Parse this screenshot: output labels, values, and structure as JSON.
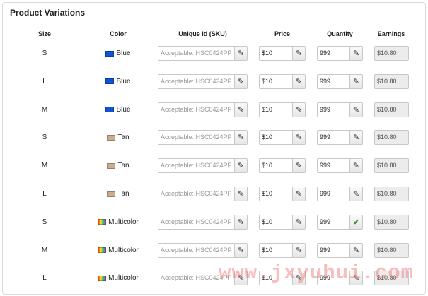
{
  "section_title": "Product Variations",
  "columns": [
    "Size",
    "Color",
    "Unique Id (SKU)",
    "Price",
    "Quantity",
    "Earnings"
  ],
  "icons": {
    "edit": "pencil-icon",
    "confirm": "checkmark-icon"
  },
  "glyphs": {
    "edit": "✎",
    "confirm": "✔"
  },
  "colors": {
    "blue": "#1152d6",
    "tan": "#c9ae8c",
    "multicolor": "linear-gradient(90deg,#e33,#f90,#ee2,#3c3,#39f,#93f)"
  },
  "rows": [
    {
      "size": "S",
      "color": "Blue",
      "swatch": "#1152d6",
      "sku_placeholder": "Acceptable: HSC0424PP",
      "price": "$10",
      "quantity": "999",
      "quantity_icon": "✎",
      "earnings": "$10.80"
    },
    {
      "size": "L",
      "color": "Blue",
      "swatch": "#1152d6",
      "sku_placeholder": "Acceptable: HSC0424PP",
      "price": "$10",
      "quantity": "999",
      "quantity_icon": "✎",
      "earnings": "$10.80"
    },
    {
      "size": "M",
      "color": "Blue",
      "swatch": "#1152d6",
      "sku_placeholder": "Acceptable: HSC0424PP",
      "price": "$10",
      "quantity": "999",
      "quantity_icon": "✎",
      "earnings": "$10.80"
    },
    {
      "size": "S",
      "color": "Tan",
      "swatch": "#c9ae8c",
      "sku_placeholder": "Acceptable: HSC0424PP",
      "price": "$10",
      "quantity": "999",
      "quantity_icon": "✎",
      "earnings": "$10.80"
    },
    {
      "size": "M",
      "color": "Tan",
      "swatch": "#c9ae8c",
      "sku_placeholder": "Acceptable: HSC0424PP",
      "price": "$10",
      "quantity": "999",
      "quantity_icon": "✎",
      "earnings": "$10.80"
    },
    {
      "size": "L",
      "color": "Tan",
      "swatch": "#c9ae8c",
      "sku_placeholder": "Acceptable: HSC0424PP",
      "price": "$10",
      "quantity": "999",
      "quantity_icon": "✎",
      "earnings": "$10.80"
    },
    {
      "size": "S",
      "color": "Multicolor",
      "swatch": "linear-gradient(90deg,#e33,#f90,#ee2,#3c3,#39f,#93f)",
      "sku_placeholder": "Acceptable: HSC0424PP",
      "price": "$10",
      "quantity": "999",
      "quantity_icon": "✔",
      "earnings": "$10.80"
    },
    {
      "size": "M",
      "color": "Multicolor",
      "swatch": "linear-gradient(90deg,#e33,#f90,#ee2,#3c3,#39f,#93f)",
      "sku_placeholder": "Acceptable: HSC0424PP",
      "price": "$10",
      "quantity": "999",
      "quantity_icon": "✎",
      "earnings": "$10.80"
    },
    {
      "size": "L",
      "color": "Multicolor",
      "swatch": "linear-gradient(90deg,#e33,#f90,#ee2,#3c3,#39f,#93f)",
      "sku_placeholder": "Acceptable: HSC0424PP",
      "price": "$10",
      "quantity": "999",
      "quantity_icon": "✎",
      "earnings": "$10.80"
    }
  ],
  "watermark": "www.jxyuhui.com"
}
